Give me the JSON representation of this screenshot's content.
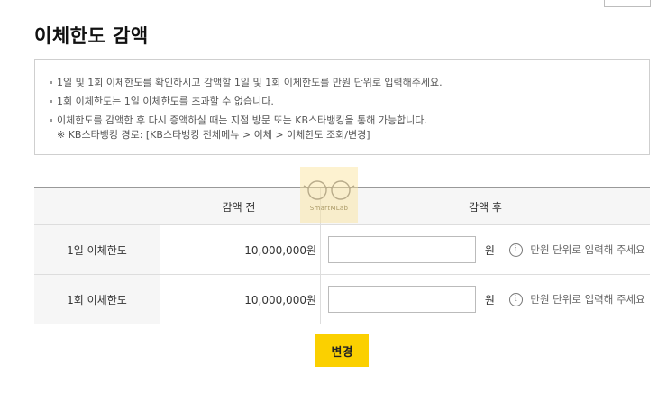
{
  "title": "이체한도 감액",
  "notices": [
    "1일 및 1회 이체한도를 확인하시고 감액할 1일 및 1회 이체한도를 만원 단위로 입력해주세요.",
    "1회 이체한도는 1일 이체한도를 초과할 수 없습니다.",
    "이체한도를 감액한 후 다시 증액하실 때는 지점 방문 또는 KB스타뱅킹을 통해 가능합니다."
  ],
  "notice_sub": "※ KB스타뱅킹 경로: [KB스타뱅킹 전체메뉴 > 이체 > 이체한도 조회/변경]",
  "table": {
    "headers": {
      "empty": "",
      "before": "감액 전",
      "after": "감액 후"
    },
    "rows": [
      {
        "label": "1일 이체한도",
        "before": "10,000,000원",
        "input_value": "",
        "unit": "원",
        "hint": "만원 단위로 입력해 주세요"
      },
      {
        "label": "1회 이체한도",
        "before": "10,000,000원",
        "input_value": "",
        "unit": "원",
        "hint": "만원 단위로 입력해 주세요"
      }
    ]
  },
  "watermark": {
    "label": "SmartMLab"
  },
  "submit_label": "변경",
  "colors": {
    "accent": "#fbd000",
    "border": "#dddddd",
    "header_bg": "#f6f6f6"
  },
  "icons": [
    "info-icon",
    "glasses-icon"
  ]
}
